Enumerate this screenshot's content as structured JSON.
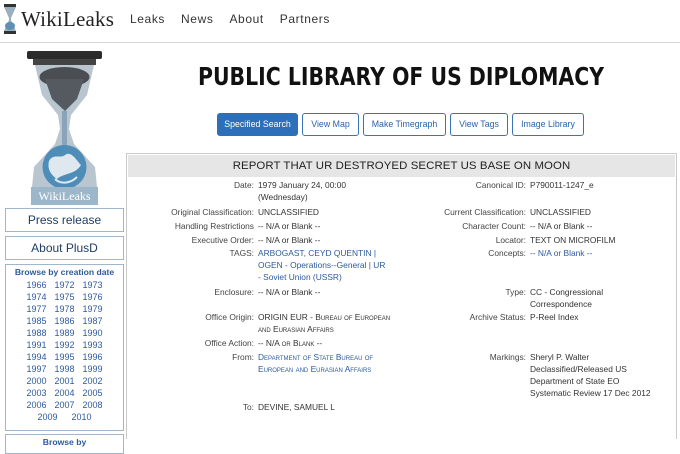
{
  "brand": {
    "name": "WikiLeaks"
  },
  "nav": {
    "items": [
      "Leaks",
      "News",
      "About",
      "Partners"
    ]
  },
  "left": {
    "press_release": "Press release",
    "about": "About PlusD",
    "browse_creation_title": "Browse by creation date",
    "years": [
      "1966",
      "1972",
      "1973",
      "1974",
      "1975",
      "1976",
      "1977",
      "1978",
      "1979",
      "1985",
      "1986",
      "1987",
      "1988",
      "1989",
      "1990",
      "1991",
      "1992",
      "1993",
      "1994",
      "1995",
      "1996",
      "1997",
      "1998",
      "1999",
      "2000",
      "2001",
      "2002",
      "2003",
      "2004",
      "2005",
      "2006",
      "2007",
      "2008"
    ],
    "years_last": [
      "2009",
      "2010"
    ],
    "browse_by": "Browse by"
  },
  "page": {
    "title": "Public Library of US Diplomacy"
  },
  "tabs": [
    "Specified Search",
    "View Map",
    "Make Timegraph",
    "View Tags",
    "Image Library"
  ],
  "report": {
    "title": "REPORT THAT UR DESTROYED SECRET US BASE ON MOON",
    "date_label": "Date:",
    "date_value_1": "1979 January 24, 00:00",
    "date_value_2": "(Wednesday)",
    "canonical_label": "Canonical ID:",
    "canonical_value": "P790011-1247_e",
    "orig_class_label": "Original Classification:",
    "orig_class_value": "UNCLASSIFIED",
    "curr_class_label": "Current Classification:",
    "curr_class_value": "UNCLASSIFIED",
    "handling_label": "Handling Restrictions",
    "handling_value": "-- N/A or Blank --",
    "charcount_label": "Character Count:",
    "charcount_value": "-- N/A or Blank --",
    "exec_label": "Executive Order:",
    "exec_value": "-- N/A or Blank --",
    "locator_label": "Locator:",
    "locator_value": "TEXT ON MICROFILM",
    "tags_label": "TAGS:",
    "tags_line1": "ARBOGAST, CEYD QUENTIN |",
    "tags_line2": "OGEN - Operations--General | UR",
    "tags_line3": "- Soviet Union (USSR)",
    "concepts_label": "Concepts:",
    "concepts_value": "-- N/A or Blank --",
    "enclosure_label": "Enclosure:",
    "enclosure_value": "-- N/A or Blank --",
    "type_label": "Type:",
    "type_value_1": "CC - Congressional",
    "type_value_2": "Correspondence",
    "office_origin_label": "Office Origin:",
    "office_origin_line1": "ORIGIN EUR - Bureau of European",
    "office_origin_line2": "and Eurasian Affairs",
    "archive_label": "Archive Status:",
    "archive_value": "P-Reel Index",
    "office_action_label": "Office Action:",
    "office_action_value": "-- N/A or Blank --",
    "from_label": "From:",
    "from_line1": "Department of State Bureau of",
    "from_line2": "European and Eurasian Affairs",
    "markings_label": "Markings:",
    "markings_line1": "Sheryl P. Walter",
    "markings_line2": "Declassified/Released US",
    "markings_line3": "Department of State EO",
    "markings_line4": "Systematic Review 17 Dec 2012",
    "to_label": "To:",
    "to_value": "DEVINE, SAMUEL L"
  },
  "colors": {
    "accent": "#2d6fb9",
    "link": "#2c5aa0",
    "border": "#9fb6cc"
  },
  "icons": [
    "wikileaks-hourglass-icon",
    "wikileaks-hourglass-logo"
  ]
}
